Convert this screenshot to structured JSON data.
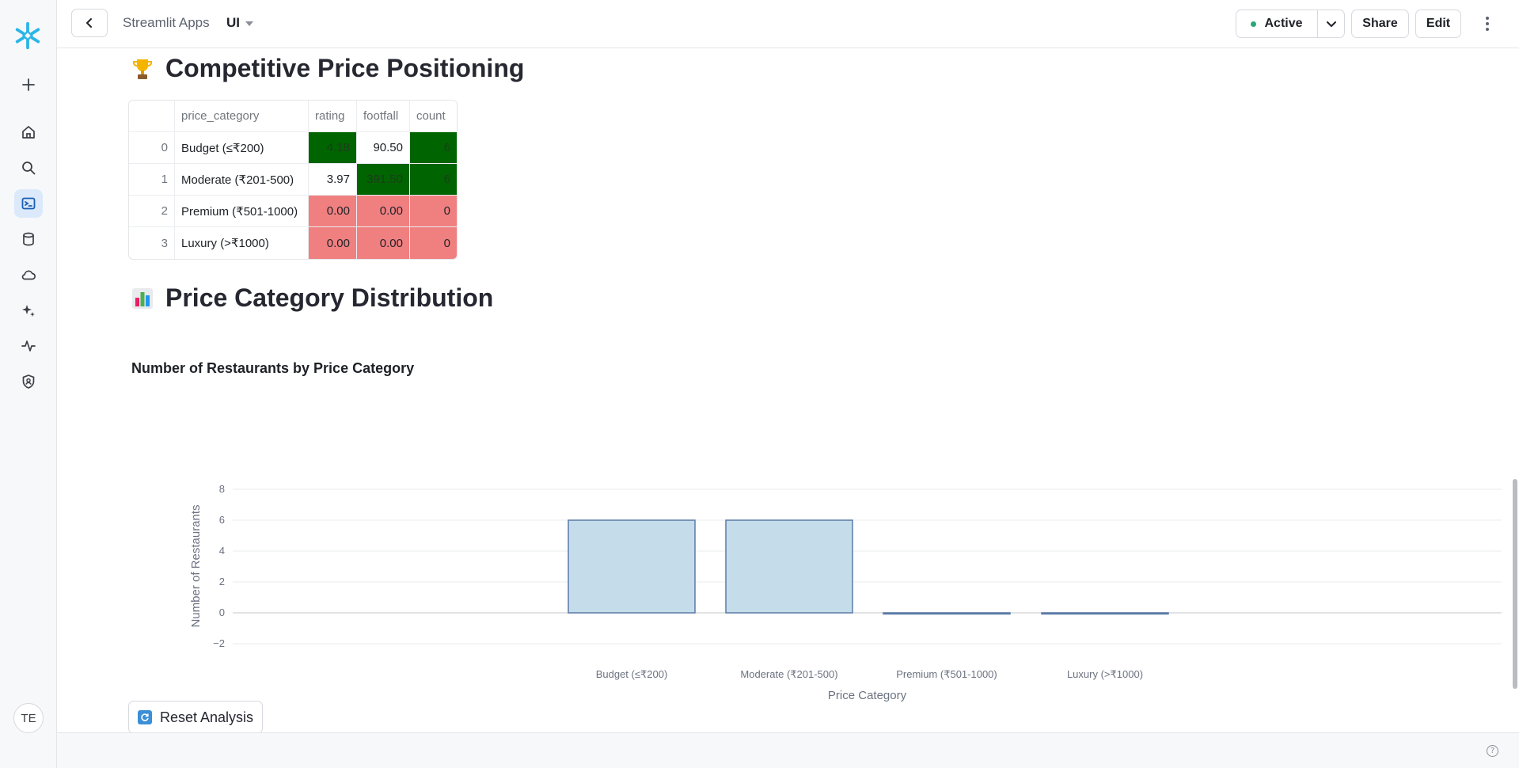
{
  "nav": {
    "avatar_initials": "TE",
    "items": [
      "add-icon",
      "home-icon",
      "search-icon",
      "streamlit-icon",
      "database-icon",
      "cloud-icon",
      "sparkle-icon",
      "activity-icon",
      "shield-icon"
    ]
  },
  "header": {
    "breadcrumb": "Streamlit Apps",
    "app_name": "UI",
    "status_label": "Active",
    "share_label": "Share",
    "edit_label": "Edit"
  },
  "section1": {
    "emoji": "trophy",
    "title": "Competitive Price Positioning"
  },
  "table": {
    "columns": [
      "",
      "price_category",
      "rating",
      "footfall",
      "count"
    ],
    "rows": [
      {
        "index": "0",
        "price_category": "Budget (≤₹200)",
        "rating": "4.18",
        "footfall": "90.50",
        "count": "6"
      },
      {
        "index": "1",
        "price_category": "Moderate (₹201-500)",
        "rating": "3.97",
        "footfall": "391.50",
        "count": "6"
      },
      {
        "index": "2",
        "price_category": "Premium (₹501-1000)",
        "rating": "0.00",
        "footfall": "0.00",
        "count": "0"
      },
      {
        "index": "3",
        "price_category": "Luxury (>₹1000)",
        "rating": "0.00",
        "footfall": "0.00",
        "count": "0"
      }
    ],
    "colors": {
      "highlight_max": "#006400",
      "highlight_min": "#f08080"
    }
  },
  "section2": {
    "emoji": "bar-chart",
    "title": "Price Category Distribution"
  },
  "chart_data": {
    "type": "bar",
    "title": "Number of Restaurants by Price Category",
    "categories": [
      "Budget (≤₹200)",
      "Moderate (₹201-500)",
      "Premium (₹501-1000)",
      "Luxury (>₹1000)"
    ],
    "values": [
      6,
      6,
      0,
      0
    ],
    "xlabel": "Price Category",
    "ylabel": "Number of Restaurants",
    "ylim": [
      -2,
      8
    ],
    "yticks": [
      8,
      6,
      4,
      2,
      0,
      -2
    ],
    "ytick_labels": [
      "8",
      "6",
      "4",
      "2",
      "0",
      "−2"
    ],
    "grid": true,
    "bar_color": "#c5dcea",
    "bar_edge": "#5b7ba8"
  },
  "reset_button": {
    "label": "Reset Analysis"
  }
}
